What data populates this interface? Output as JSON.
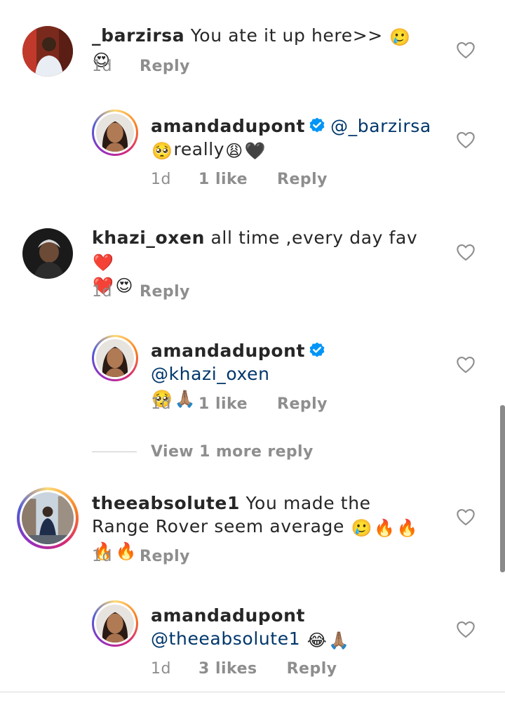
{
  "comments": [
    {
      "username": "_barzirsa",
      "text": "You ate it up here>>",
      "emojis": [
        "🥲",
        "😍"
      ],
      "time": "1d",
      "reply_label": "Reply"
    },
    {
      "username": "amandadupont",
      "verified": true,
      "mention": "@_barzirsa",
      "emoji_lead": "🥺",
      "text": "really",
      "emojis": [
        "😩",
        "🖤"
      ],
      "time": "1d",
      "likes": "1 like",
      "reply_label": "Reply"
    },
    {
      "username": "khazi_oxen",
      "text": "all time ,every day fav",
      "emojis": [
        "❤️",
        "❤️",
        "😍"
      ],
      "time": "1d",
      "reply_label": "Reply"
    },
    {
      "username": "amandadupont",
      "verified": true,
      "mention": "@khazi_oxen",
      "emojis": [
        "🥺",
        "🙏🏽"
      ],
      "time": "1d",
      "likes": "1 like",
      "reply_label": "Reply"
    },
    {
      "username": "theeabsolute1",
      "text": "You made the Range Rover seem average",
      "emojis": [
        "🥲",
        "🔥",
        "🔥",
        "🔥",
        "🔥"
      ],
      "time": "1d",
      "reply_label": "Reply"
    },
    {
      "username": "amandadupont",
      "mention": "@theeabsolute1",
      "emojis": [
        "😂",
        "🙏🏽"
      ],
      "time": "1d",
      "likes": "3 likes",
      "reply_label": "Reply"
    }
  ],
  "view_more_replies": "View 1 more reply",
  "icons": {
    "like": "heart-outline-icon",
    "verified": "verified-badge-icon"
  },
  "colors": {
    "mention": "#00376b",
    "verified": "#0095f6",
    "meta_text": "#8e8e8e"
  }
}
